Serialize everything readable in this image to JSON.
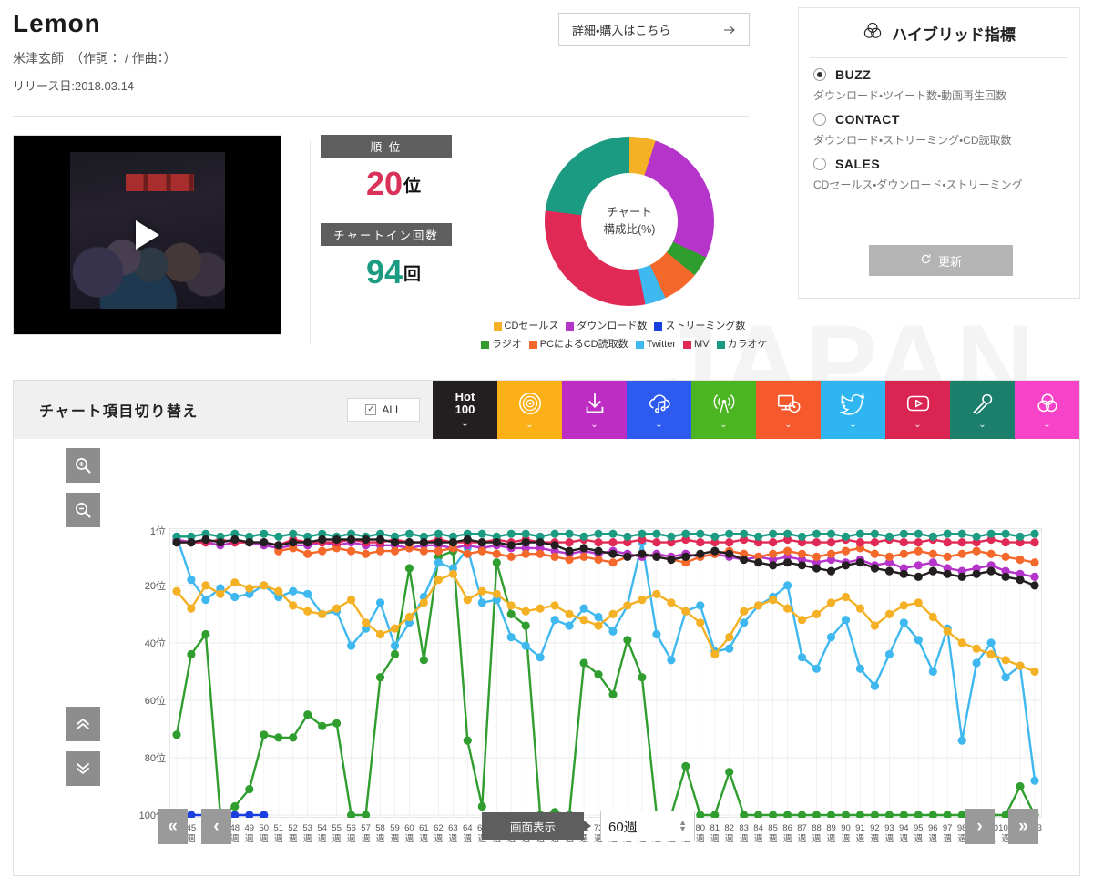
{
  "song": {
    "title": "Lemon",
    "artist": "米津玄師　（作詞： / 作曲：）",
    "release": "リリース日:2018.03.14",
    "buy_label": "詳細・購入はこちら",
    "buy_arrow": "⌐"
  },
  "hybrid": {
    "title": "ハイブリッド指標",
    "icon": "venn-icon",
    "options": [
      {
        "name": "BUZZ",
        "desc": "ダウンロード・ツイート数・動画再生回数",
        "selected": true
      },
      {
        "name": "CONTACT",
        "desc": "ダウンロード・ストリーミング・CD読取数",
        "selected": false
      },
      {
        "name": "SALES",
        "desc": "CDセールス・ダウンロード・ストリーミング",
        "selected": false
      }
    ],
    "refresh_label": "更新",
    "refresh_icon": "refresh-icon"
  },
  "stats": {
    "rank_label": "順 位",
    "rank_value": "20",
    "rank_unit": "位",
    "rank_color": "#d9315a",
    "chartin_label": "チャートイン回数",
    "chartin_value": "94",
    "chartin_unit": "回",
    "chartin_color": "#1b9b82"
  },
  "video": {
    "play_label": "play-button"
  },
  "chart_data": {
    "type": "pie",
    "title": "チャート",
    "subtitle": "構成比(%)",
    "legend_position": "bottom",
    "categories": [
      "CDセールス",
      "ダウンロード数",
      "ストリーミング数",
      "ラジオ",
      "PCによるCD読取数",
      "Twitter",
      "MV",
      "カラオケ"
    ],
    "colors": [
      "#f5b125",
      "#b534c9",
      "#1a3fe0",
      "#2f9e2f",
      "#f4682c",
      "#3fb8ef",
      "#e02a55",
      "#1b9b82"
    ],
    "values": [
      5,
      27,
      0,
      4,
      7,
      4,
      30,
      23
    ]
  },
  "graph": {
    "toolbar_title": "チャート項目切り替え",
    "all_label": "ALL",
    "all_checked": true,
    "tabs": [
      {
        "label": "Hot\n100",
        "icon": "hot100-text",
        "color": "#231f20"
      },
      {
        "label": "",
        "icon": "vinyl-record-icon",
        "color": "#fbb018"
      },
      {
        "label": "",
        "icon": "download-icon",
        "color": "#bd2dc4"
      },
      {
        "label": "",
        "icon": "cloud-music-icon",
        "color": "#2d5bf0"
      },
      {
        "label": "",
        "icon": "radio-tower-icon",
        "color": "#4cb522"
      },
      {
        "label": "",
        "icon": "monitor-disc-icon",
        "color": "#f65a2c"
      },
      {
        "label": "",
        "icon": "twitter-icon",
        "color": "#2fb6f0"
      },
      {
        "label": "",
        "icon": "youtube-icon",
        "color": "#da2452"
      },
      {
        "label": "",
        "icon": "microphone-icon",
        "color": "#1b7f6c"
      },
      {
        "label": "",
        "icon": "venn-icon",
        "color": "#f743c8"
      }
    ],
    "chevron": "⌄",
    "y_labels": [
      "1位",
      "20位",
      "40位",
      "60位",
      "80位",
      "100位"
    ],
    "y_values": [
      1,
      20,
      40,
      60,
      80,
      100
    ],
    "x_start_week": 44,
    "x_end_week": 103,
    "week_suffix": "週",
    "zoom_in_icon": "zoom-in-icon",
    "zoom_out_icon": "zoom-out-icon",
    "up_icon": "chevron-double-up-icon",
    "down_icon": "chevron-double-down-icon",
    "first_icon": "«",
    "prev_icon": "‹",
    "next_icon": "›",
    "last_icon": "»",
    "screen_label": "画面表示",
    "weeks_value": "60週",
    "series": [
      {
        "name": "Hot 100",
        "color": "#231f20",
        "values": [
          5,
          5,
          4,
          5,
          4,
          5,
          5,
          6,
          5,
          5,
          4,
          4,
          4,
          4,
          4,
          5,
          5,
          5,
          5,
          5,
          4,
          5,
          5,
          6,
          5,
          5,
          6,
          8,
          7,
          8,
          9,
          10,
          9,
          10,
          11,
          10,
          9,
          8,
          9,
          11,
          12,
          13,
          12,
          13,
          14,
          15,
          13,
          12,
          14,
          15,
          16,
          17,
          15,
          16,
          17,
          16,
          15,
          17,
          18,
          20
        ]
      },
      {
        "name": "CDセールス",
        "color": "#f5b125",
        "values": [
          22,
          28,
          20,
          23,
          19,
          21,
          20,
          22,
          27,
          29,
          30,
          28,
          25,
          33,
          37,
          35,
          31,
          26,
          18,
          16,
          25,
          22,
          23,
          27,
          29,
          28,
          27,
          30,
          32,
          34,
          30,
          27,
          25,
          23,
          26,
          29,
          33,
          44,
          38,
          29,
          27,
          25,
          28,
          32,
          30,
          26,
          24,
          28,
          34,
          30,
          27,
          26,
          31,
          36,
          40,
          42,
          44,
          46,
          48,
          50
        ]
      },
      {
        "name": "ストリーミング数",
        "color": "#1a3fe0",
        "values": [
          100,
          100,
          100,
          100,
          100,
          100,
          100,
          null,
          null,
          null,
          null,
          null,
          null,
          null,
          null,
          null,
          null,
          null,
          null,
          null,
          null,
          null,
          null,
          null,
          null,
          null,
          null,
          null,
          null,
          null,
          null,
          null,
          null,
          null,
          null,
          null,
          null,
          null,
          null,
          null,
          null,
          null,
          null,
          null,
          null,
          null,
          null,
          null,
          null,
          null,
          null,
          null,
          null,
          null,
          null,
          null,
          null,
          null,
          null,
          null
        ]
      },
      {
        "name": "ラジオ",
        "color": "#2f9e2f",
        "values": [
          72,
          44,
          37,
          100,
          97,
          91,
          72,
          73,
          73,
          65,
          69,
          68,
          100,
          100,
          52,
          44,
          14,
          46,
          10,
          8,
          74,
          97,
          12,
          30,
          34,
          100,
          99,
          100,
          47,
          51,
          58,
          39,
          52,
          100,
          100,
          83,
          100,
          100,
          85,
          100,
          100,
          100,
          100,
          100,
          100,
          100,
          100,
          100,
          100,
          100,
          100,
          100,
          100,
          100,
          100,
          100,
          100,
          100,
          90,
          100
        ]
      },
      {
        "name": "PCによるCD読取数",
        "color": "#f4682c",
        "values": [
          null,
          null,
          null,
          null,
          null,
          null,
          null,
          8,
          7,
          9,
          8,
          7,
          8,
          9,
          8,
          8,
          7,
          8,
          8,
          7,
          9,
          8,
          9,
          10,
          9,
          9,
          10,
          11,
          10,
          11,
          12,
          10,
          9,
          10,
          11,
          12,
          10,
          9,
          8,
          9,
          10,
          9,
          8,
          9,
          10,
          9,
          8,
          7,
          9,
          10,
          9,
          8,
          9,
          10,
          9,
          8,
          9,
          10,
          11,
          12
        ]
      },
      {
        "name": "Twitter",
        "color": "#3fb8ef",
        "values": [
          3,
          18,
          25,
          21,
          24,
          23,
          20,
          24,
          22,
          23,
          30,
          29,
          41,
          35,
          26,
          41,
          33,
          24,
          12,
          14,
          7,
          26,
          25,
          38,
          41,
          45,
          32,
          34,
          28,
          31,
          36,
          27,
          5,
          37,
          46,
          29,
          27,
          43,
          42,
          33,
          27,
          24,
          20,
          45,
          49,
          38,
          32,
          49,
          55,
          44,
          33,
          39,
          50,
          35,
          74,
          47,
          40,
          52,
          48,
          88
        ]
      },
      {
        "name": "MV",
        "color": "#e02a55",
        "values": [
          5,
          5,
          5,
          4,
          5,
          5,
          5,
          6,
          4,
          5,
          5,
          5,
          4,
          5,
          5,
          4,
          5,
          5,
          4,
          5,
          5,
          5,
          4,
          5,
          4,
          5,
          5,
          5,
          4,
          5,
          5,
          5,
          4,
          5,
          5,
          4,
          5,
          5,
          5,
          4,
          5,
          5,
          4,
          5,
          5,
          5,
          4,
          5,
          5,
          4,
          5,
          5,
          4,
          5,
          5,
          5,
          4,
          5,
          5,
          5
        ]
      },
      {
        "name": "カラオケ",
        "color": "#1b9b82",
        "values": [
          3,
          3,
          2,
          3,
          2,
          3,
          2,
          3,
          2,
          3,
          2,
          3,
          2,
          3,
          2,
          3,
          2,
          3,
          2,
          3,
          2,
          2,
          3,
          2,
          2,
          3,
          2,
          2,
          3,
          2,
          2,
          3,
          2,
          2,
          3,
          2,
          2,
          3,
          2,
          2,
          3,
          2,
          2,
          3,
          2,
          2,
          3,
          2,
          2,
          3,
          2,
          2,
          3,
          2,
          2,
          3,
          2,
          2,
          3,
          2
        ]
      },
      {
        "name": "ダウンロード数",
        "color": "#b534c9",
        "values": [
          4,
          5,
          5,
          6,
          5,
          5,
          6,
          7,
          6,
          6,
          5,
          6,
          5,
          6,
          6,
          6,
          7,
          6,
          6,
          7,
          6,
          7,
          6,
          7,
          7,
          7,
          8,
          9,
          8,
          9,
          8,
          9,
          10,
          9,
          10,
          9,
          10,
          9,
          10,
          11,
          10,
          11,
          10,
          11,
          12,
          11,
          12,
          11,
          13,
          12,
          14,
          13,
          12,
          14,
          15,
          14,
          13,
          15,
          16,
          17
        ]
      }
    ]
  }
}
